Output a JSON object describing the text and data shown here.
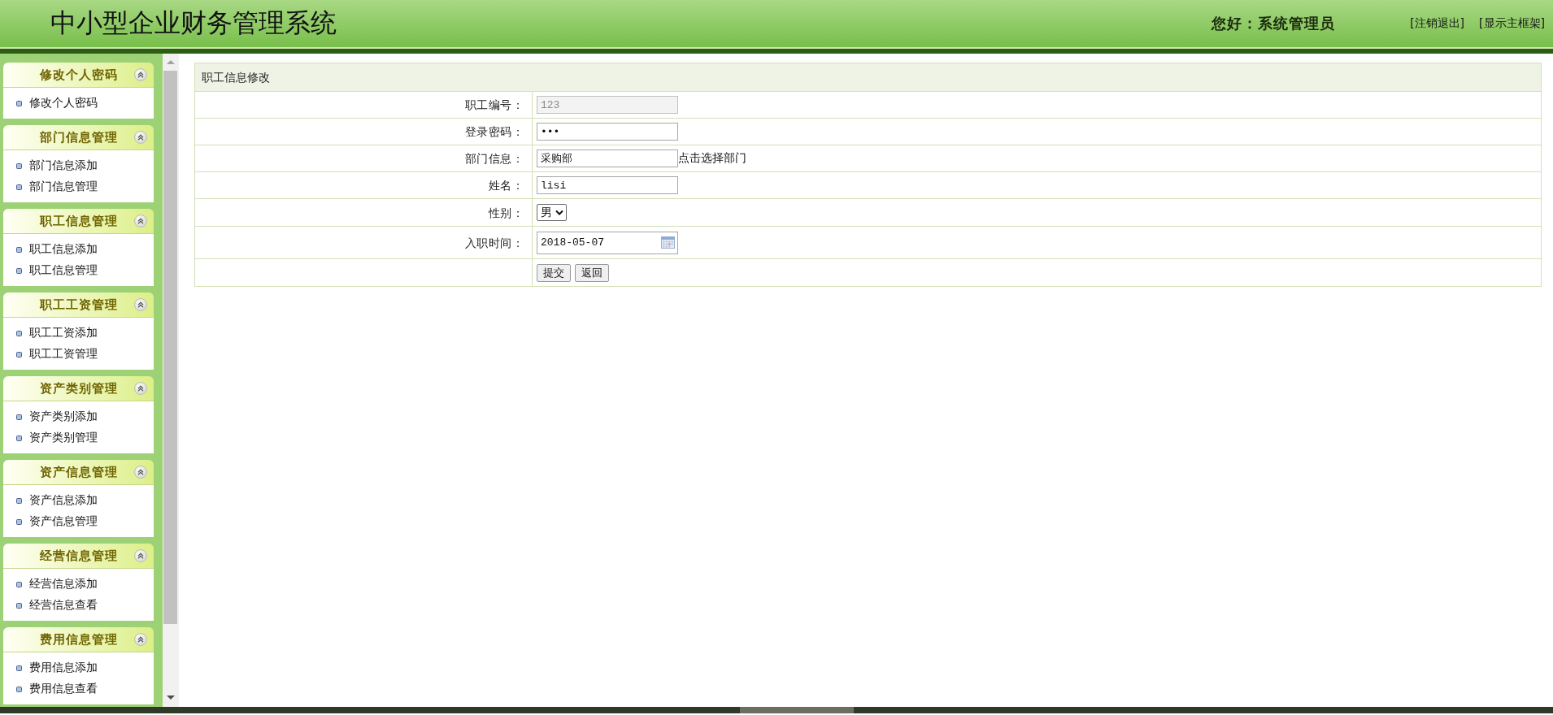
{
  "header": {
    "title": "中小型企业财务管理系统",
    "greeting": "您好：系统管理员",
    "links": [
      "[注销退出]",
      "[显示主框架]"
    ]
  },
  "sidebar": {
    "panels": [
      {
        "title": "修改个人密码",
        "expanded": true,
        "items": [
          "修改个人密码"
        ]
      },
      {
        "title": "部门信息管理",
        "expanded": true,
        "items": [
          "部门信息添加",
          "部门信息管理"
        ]
      },
      {
        "title": "职工信息管理",
        "expanded": true,
        "items": [
          "职工信息添加",
          "职工信息管理"
        ]
      },
      {
        "title": "职工工资管理",
        "expanded": true,
        "items": [
          "职工工资添加",
          "职工工资管理"
        ]
      },
      {
        "title": "资产类别管理",
        "expanded": true,
        "items": [
          "资产类别添加",
          "资产类别管理"
        ]
      },
      {
        "title": "资产信息管理",
        "expanded": true,
        "items": [
          "资产信息添加",
          "资产信息管理"
        ]
      },
      {
        "title": "经营信息管理",
        "expanded": true,
        "items": [
          "经营信息添加",
          "经营信息查看"
        ]
      },
      {
        "title": "费用信息管理",
        "expanded": true,
        "items": [
          "费用信息添加",
          "费用信息查看"
        ]
      }
    ]
  },
  "form": {
    "title": "职工信息修改",
    "fields": [
      {
        "label": "职工编号：",
        "kind": "text",
        "value": "123",
        "disabled": true
      },
      {
        "label": "登录密码：",
        "kind": "password",
        "value": "•••",
        "disabled": false
      },
      {
        "label": "部门信息：",
        "kind": "text",
        "value": "采购部",
        "disabled": false,
        "action": "点击选择部门"
      },
      {
        "label": "姓名：",
        "kind": "text",
        "value": "lisi",
        "disabled": false
      },
      {
        "label": "性别：",
        "kind": "select",
        "value": "男",
        "disabled": false
      },
      {
        "label": "入职时间：",
        "kind": "date",
        "value": "2018-05-07",
        "disabled": false
      }
    ],
    "buttons": [
      "提交",
      "返回"
    ]
  }
}
